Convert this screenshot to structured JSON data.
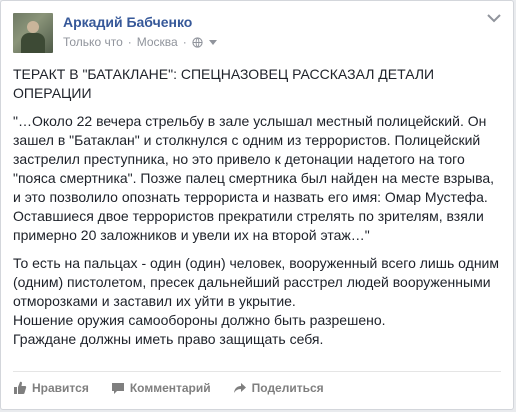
{
  "post": {
    "author": "Аркадий Бабченко",
    "time": "Только что",
    "location": "Москва",
    "headline": "ТЕРАКТ В \"БАТАКЛАНЕ\": СПЕЦНАЗОВЕЦ РАССКАЗАЛ ДЕТАЛИ ОПЕРАЦИИ",
    "quote": "\"…Около 22 вечера стрельбу в зале услышал местный полицейский. Он зашел в \"Батаклан\" и столкнулся с одним из террористов. Полицейский застрелил преступника, но это привело к детонации надетого на того \"пояса смертника\". Позже палец смертника был найден на месте взрыва, и это позволило опознать террориста и назвать его имя: Омар Мустефа. Оставшиеся двое террористов прекратили стрелять по зрителям, взяли примерно 20 заложников и увели их на второй этаж…\"",
    "body_lines": [
      "То есть на пальцах - один (один) человек, вооруженный всего лишь одним (одним) пистолетом, пресек дальнейший расстрел людей вооруженными отморозками и заставил их уйти в укрытие.",
      "Ношение оружия самообороны должно быть разрешено.",
      "Граждане должны иметь право защищать себя."
    ]
  },
  "actions": {
    "like": "Нравится",
    "comment": "Комментарий",
    "share": "Поделиться"
  },
  "colors": {
    "link": "#365899",
    "meta": "#90949c",
    "text": "#1d2129"
  }
}
